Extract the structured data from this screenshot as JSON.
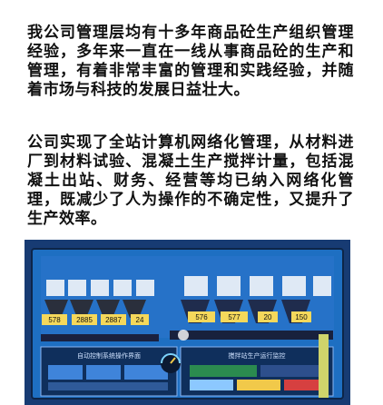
{
  "article": {
    "paragraph_1": "我公司管理层均有十多年商品砼生产组织管理经验，多年来一直在一线从事商品砼的生产和管理，有着非常丰富的管理和实践经验，并随着市场与科技的发展日益壮大。",
    "paragraph_2": "公司实现了全站计算机网络化管理，从材料进厂到材料试验、混凝土生产搅拌计量，包括混凝土出站、财务、经营等均已纳入网络化管理，既减少了人为操作的不确定性，又提升了生产效率。"
  },
  "photo": {
    "description_icon": "control-room-monitor-icon",
    "screen_readouts": [
      "578",
      "2885",
      "2887",
      "24",
      "576",
      "577",
      "20",
      "150"
    ],
    "left_panel_title": "自动控制系统操作界面",
    "right_panel_title": "搅拌站生产运行监控",
    "colors": {
      "screen_blue": "#1e6fc2",
      "panel_dark": "#0f2f5c",
      "accent_yellow": "#f1c94a",
      "accent_green": "#38b866",
      "accent_red": "#d64040"
    }
  }
}
